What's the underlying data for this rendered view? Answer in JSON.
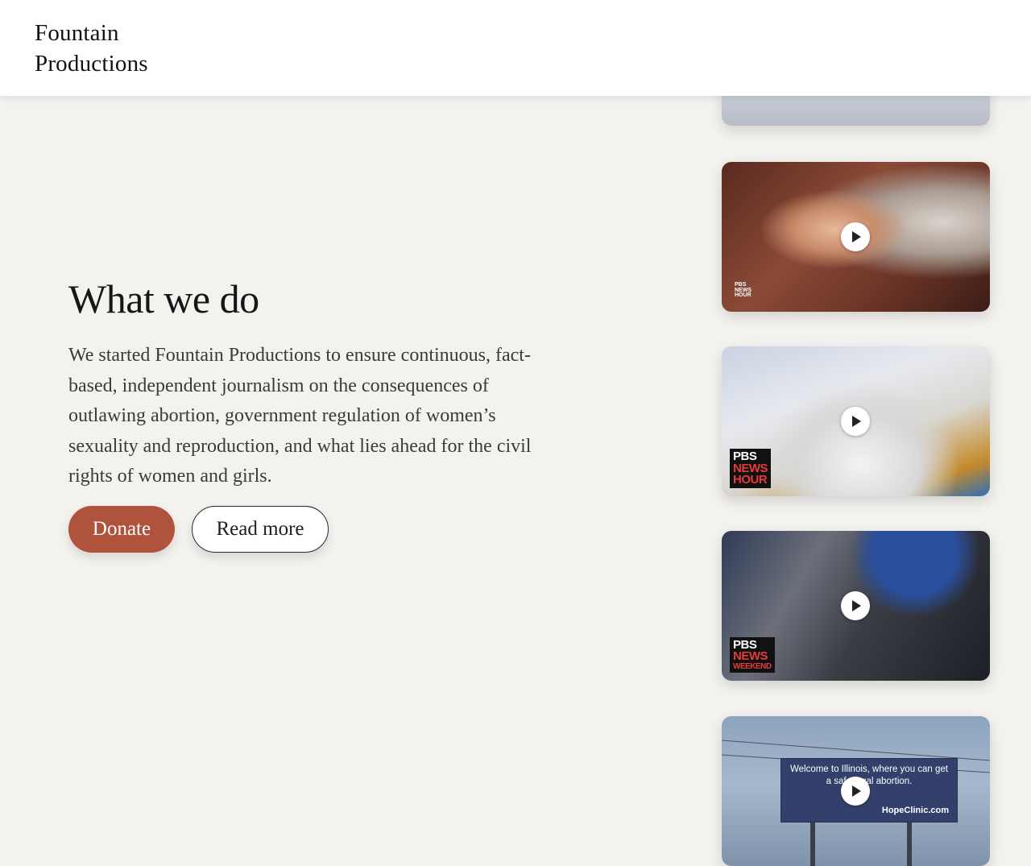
{
  "header": {
    "logo_line1": "Fountain",
    "logo_line2": "Productions"
  },
  "main": {
    "title": "What we do",
    "description": "We started Fountain Productions to ensure continuous, fact-based, independent journalism on the consequences of outlawing abortion, government regulation of women’s sexuality and reproduction, and what lies ahead for the civil rights of women and girls.",
    "donate_label": "Donate",
    "read_more_label": "Read more"
  },
  "videos": [
    {
      "badge": ""
    },
    {
      "badge_lines": [
        "PBS",
        "NEWS",
        "HOUR"
      ]
    },
    {
      "badge_lines": [
        "PBS",
        "NEWS",
        "HOUR"
      ]
    },
    {
      "badge_lines": [
        "PBS",
        "NEWS",
        "WEEKEND"
      ]
    },
    {
      "billboard_line1": "Welcome to Illinois, where you can get",
      "billboard_line2": "a safe legal abortion.",
      "billboard_url": "HopeClinic.com"
    }
  ],
  "colors": {
    "background": "#f4f2ef",
    "donate_button": "#b0533c",
    "header": "#ffffff"
  },
  "icons": [
    "play-icon"
  ]
}
